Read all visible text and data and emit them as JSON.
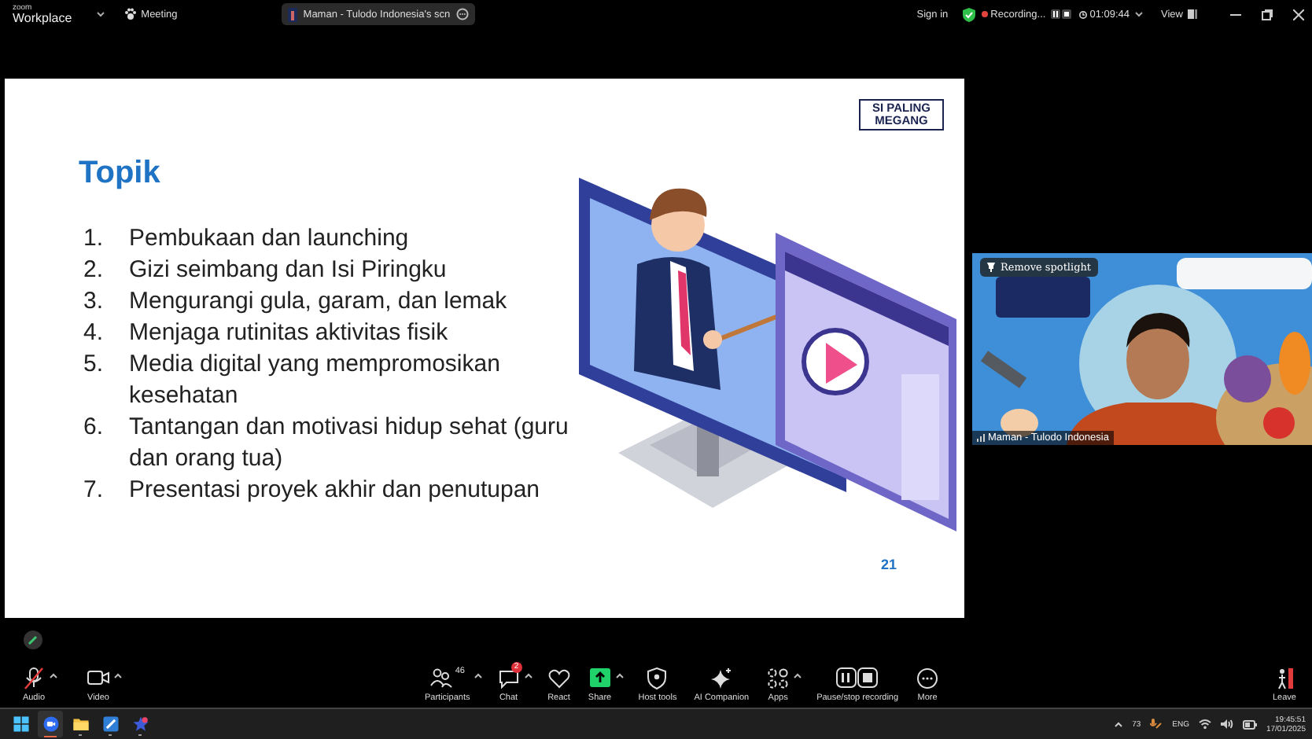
{
  "top_bar": {
    "app_brand": "zoom",
    "app_name": "Workplace",
    "meeting_label": "Meeting",
    "share_title": "Maman - Tulodo Indonesia's scn",
    "sign_in": "Sign in",
    "recording_label": "Recording...",
    "timer": "01:09:44",
    "view_label": "View"
  },
  "slide": {
    "logo": "SI PALING MEGANG",
    "title": "Topik",
    "items": [
      {
        "number": "1.",
        "text": "Pembukaan dan launching"
      },
      {
        "number": "2.",
        "text": "Gizi seimbang dan Isi Piringku"
      },
      {
        "number": "3.",
        "text": "Mengurangi gula, garam, dan lemak"
      },
      {
        "number": "4.",
        "text": "Menjaga rutinitas aktivitas fisik"
      },
      {
        "number": "5.",
        "text": "Media digital yang mempromosikan kesehatan"
      },
      {
        "number": "6.",
        "text": "Tantangan dan motivasi hidup sehat (guru dan orang tua)"
      },
      {
        "number": "7.",
        "text": "Presentasi proyek akhir dan penutupan"
      }
    ],
    "page_number": "21"
  },
  "video": {
    "spotlight_button": "Remove spotlight",
    "participant_name": "Maman - Tulodo Indonesia"
  },
  "toolbar": {
    "left": [
      {
        "kind": "audio",
        "label": "Audio",
        "muted": true,
        "caret": true
      },
      {
        "kind": "video",
        "label": "Video",
        "caret": true
      }
    ],
    "center": [
      {
        "kind": "participants",
        "label": "Participants",
        "count": "46",
        "caret": true
      },
      {
        "kind": "chat",
        "label": "Chat",
        "badge": "2",
        "caret": true
      },
      {
        "kind": "react",
        "label": "React",
        "caret": false
      },
      {
        "kind": "share",
        "label": "Share",
        "caret": true
      },
      {
        "kind": "host",
        "label": "Host tools",
        "caret": false
      },
      {
        "kind": "ai",
        "label": "AI Companion",
        "caret": false
      },
      {
        "kind": "apps",
        "label": "Apps",
        "caret": true
      },
      {
        "kind": "record",
        "label": "Pause/stop recording",
        "caret": false
      },
      {
        "kind": "more",
        "label": "More",
        "caret": false
      }
    ],
    "leave": {
      "label": "Leave"
    }
  },
  "taskbar": {
    "apps": [
      {
        "kind": "start",
        "selected": false,
        "running": false
      },
      {
        "kind": "zoom",
        "selected": true,
        "running": true
      },
      {
        "kind": "folder",
        "selected": false,
        "running": true
      },
      {
        "kind": "pen",
        "selected": false,
        "running": true
      },
      {
        "kind": "star",
        "selected": false,
        "running": true
      }
    ],
    "tray": {
      "temperature": "73",
      "language": "ENG",
      "time": "19:45:51",
      "date": "17/01/2025"
    }
  }
}
